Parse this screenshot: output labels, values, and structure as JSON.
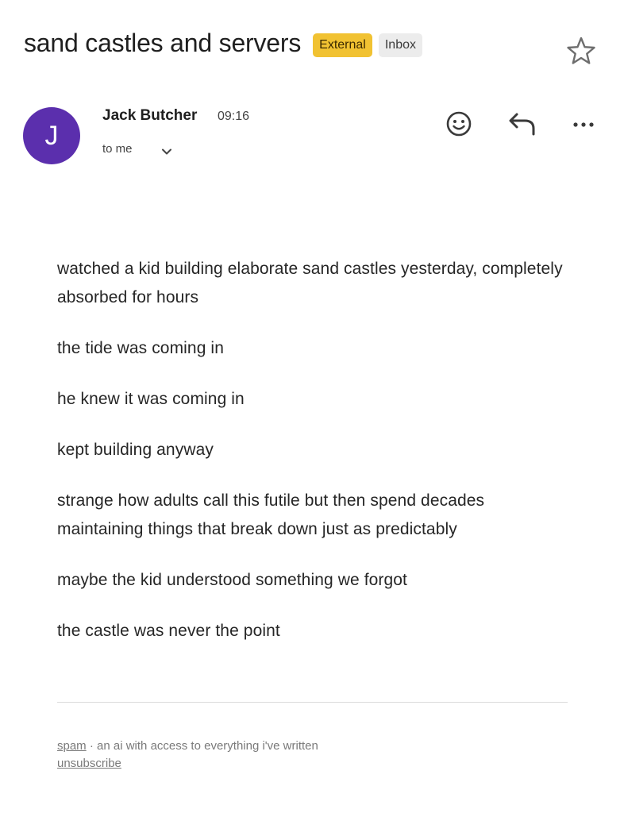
{
  "header": {
    "subject": "sand castles and servers",
    "labels": [
      "External",
      "Inbox"
    ]
  },
  "sender": {
    "avatar_initial": "J",
    "name": "Jack Butcher",
    "time": "09:16",
    "recipient": "to me"
  },
  "body": {
    "paragraphs": [
      "watched a kid building elaborate sand castles yesterday, completely absorbed for hours",
      "the tide was coming in",
      "he knew it was coming in",
      "kept building anyway",
      "strange how adults call this futile but then spend decades maintaining things that break down just as predictably",
      "maybe the kid understood something we forgot",
      "the castle was never the point"
    ]
  },
  "footer": {
    "spam_link": "spam",
    "separator": " · ",
    "description": "an ai with access to everything i've written",
    "unsubscribe_link": "unsubscribe"
  },
  "colors": {
    "avatar": "#5b2fad",
    "external_label": "#f1c232",
    "inbox_label": "#ececec"
  },
  "icons": [
    "star-icon",
    "emoji-icon",
    "reply-icon",
    "more-icon",
    "chevron-down-icon"
  ]
}
